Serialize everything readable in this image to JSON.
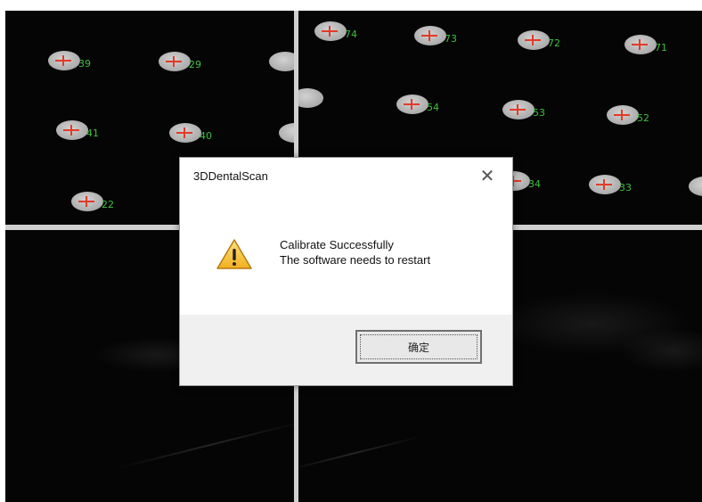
{
  "dialog": {
    "title": "3DDentalScan",
    "close_glyph": "✕",
    "message_line1": "Calibrate Successfully",
    "message_line2": "The software needs to restart",
    "ok_label": "确定",
    "icon": "warning-icon"
  },
  "markers": {
    "top_left": [
      "39",
      "29",
      "41",
      "40",
      "22"
    ],
    "top_right": [
      "74",
      "73",
      "72",
      "71",
      "54",
      "53",
      "52",
      "34",
      "33"
    ]
  },
  "colors": {
    "marker_label": "#3fbf3f",
    "marker_cross": "#e23b28",
    "background": "#0a0a0a"
  }
}
